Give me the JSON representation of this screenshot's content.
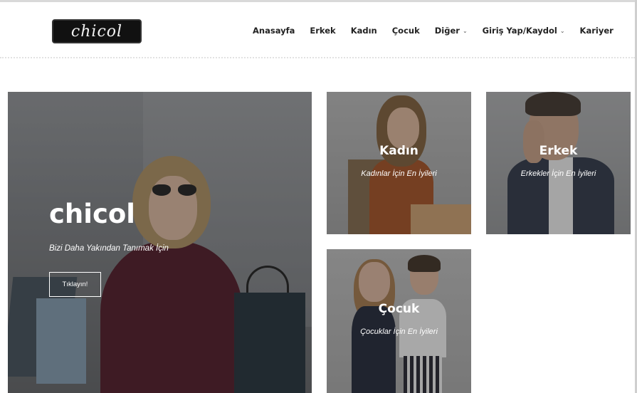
{
  "header": {
    "logo_text": "chicol",
    "nav": [
      {
        "label": "Anasayfa",
        "dropdown": false
      },
      {
        "label": "Erkek",
        "dropdown": false
      },
      {
        "label": "Kadın",
        "dropdown": false
      },
      {
        "label": "Çocuk",
        "dropdown": false
      },
      {
        "label": "Diğer",
        "dropdown": true
      },
      {
        "label": "Giriş Yap/Kaydol",
        "dropdown": true
      },
      {
        "label": "Kariyer",
        "dropdown": false
      }
    ]
  },
  "hero": {
    "title": "chicol",
    "subtitle": "Bizi Daha Yakından Tanımak İçin",
    "button_label": "Tıklayın!"
  },
  "tiles": {
    "kadin": {
      "title": "Kadın",
      "subtitle": "Kadınlar İçin En İyileri"
    },
    "erkek": {
      "title": "Erkek",
      "subtitle": "Erkekler İçin En İyileri"
    },
    "cocuk": {
      "title": "Çocuk",
      "subtitle": "Çocuklar İçin En İyileri"
    }
  },
  "icons": {
    "dropdown": "chevron-down-icon"
  },
  "colors": {
    "text_dark": "#222222",
    "overlay": "#282828",
    "white": "#ffffff",
    "logo_bg": "#111111"
  }
}
